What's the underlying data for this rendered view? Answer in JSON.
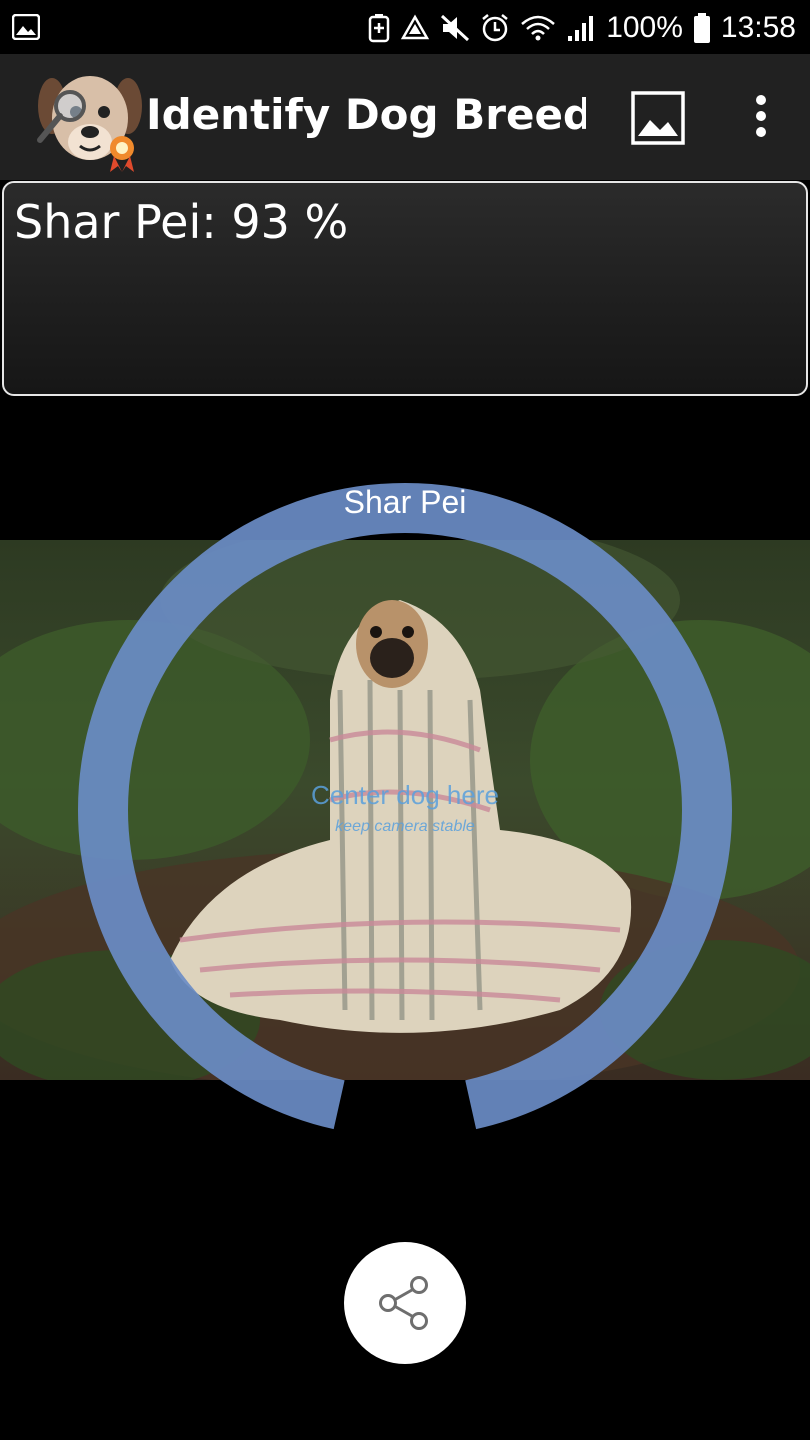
{
  "status_bar": {
    "battery_percent": "100%",
    "time": "13:58",
    "icons": [
      "gallery-icon",
      "battery-saver-icon",
      "recycle-icon",
      "mute-icon",
      "alarm-icon",
      "wifi-icon",
      "signal-icon",
      "battery-icon"
    ]
  },
  "app_bar": {
    "title": "Identify Dog Breeds...",
    "logo_icon": "dog-magnifier-logo",
    "actions": [
      "gallery-icon",
      "more-vert-icon"
    ]
  },
  "result": {
    "text": "Shar Pei: 93 %"
  },
  "camera": {
    "ring_label": "Shar Pei",
    "ring_progress_percent": 93,
    "hint": "Center dog here",
    "subhint": "keep camera stable"
  },
  "share": {
    "icon": "share-icon"
  },
  "colors": {
    "ring": "#6a8cc6",
    "app_bar": "#212121",
    "hint": "#5aa0dc"
  }
}
